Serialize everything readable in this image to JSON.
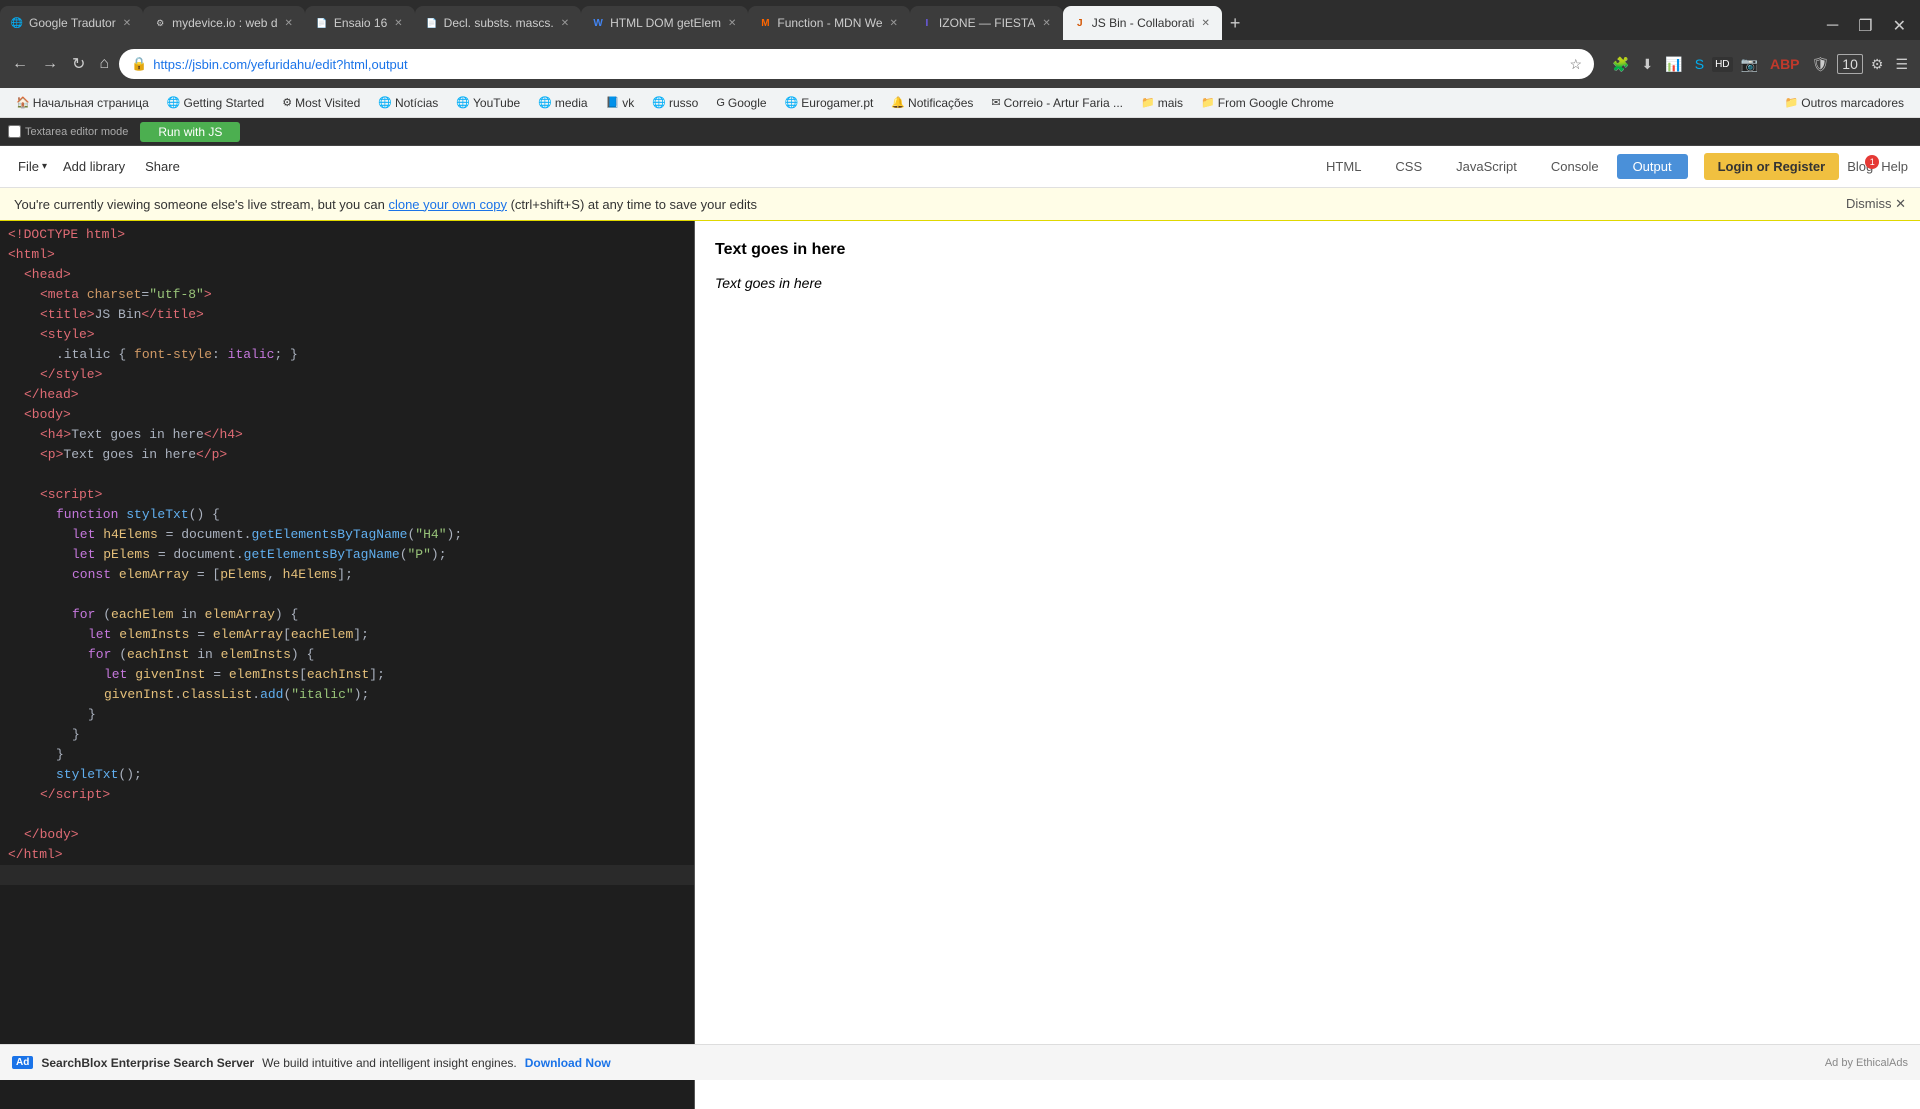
{
  "browser": {
    "tabs": [
      {
        "id": 1,
        "favicon": "🌐",
        "label": "Google Tradutor",
        "active": false,
        "closeable": true
      },
      {
        "id": 2,
        "favicon": "⚙️",
        "label": "mydevice.io : web d",
        "active": false,
        "closeable": true
      },
      {
        "id": 3,
        "favicon": "📄",
        "label": "Ensaio 16",
        "active": false,
        "closeable": true
      },
      {
        "id": 4,
        "favicon": "📄",
        "label": "Decl. substs. mascs.",
        "active": false,
        "closeable": true
      },
      {
        "id": 5,
        "favicon": "W",
        "label": "HTML DOM getElem",
        "active": false,
        "closeable": true
      },
      {
        "id": 6,
        "favicon": "M",
        "label": "Function - MDN We",
        "active": false,
        "closeable": true
      },
      {
        "id": 7,
        "favicon": "I",
        "label": "IZONE — FIESTA",
        "active": false,
        "closeable": true
      },
      {
        "id": 8,
        "favicon": "J",
        "label": "JS Bin - Collaborati",
        "active": true,
        "closeable": true
      }
    ],
    "url": "https://jsbin.com/yefuridahu/edit?html,output",
    "bookmarks": [
      {
        "icon": "🏠",
        "label": "Начальная страница"
      },
      {
        "icon": "🌐",
        "label": "Getting Started"
      },
      {
        "icon": "⚙️",
        "label": "Most Visited"
      },
      {
        "icon": "📰",
        "label": "Notícias"
      },
      {
        "icon": "▶️",
        "label": "YouTube"
      },
      {
        "icon": "🌐",
        "label": "media"
      },
      {
        "icon": "📘",
        "label": "vk"
      },
      {
        "icon": "🌐",
        "label": "russo"
      },
      {
        "icon": "G",
        "label": "Google"
      },
      {
        "icon": "🌐",
        "label": "Eurogamer.pt"
      },
      {
        "icon": "🔔",
        "label": "Notificações"
      },
      {
        "icon": "✉️",
        "label": "Correio - Artur Faria ..."
      },
      {
        "icon": "📁",
        "label": "mais"
      },
      {
        "icon": "📁",
        "label": "From Google Chrome"
      },
      {
        "icon": "📁",
        "label": "Outros marcadores"
      }
    ]
  },
  "jsbin": {
    "file_label": "File",
    "add_library_label": "Add library",
    "share_label": "Share",
    "panels": [
      {
        "id": "html",
        "label": "HTML",
        "active": false
      },
      {
        "id": "css",
        "label": "CSS",
        "active": false
      },
      {
        "id": "javascript",
        "label": "JavaScript",
        "active": false
      },
      {
        "id": "console",
        "label": "Console",
        "active": false
      },
      {
        "id": "output",
        "label": "Output",
        "active": true
      }
    ],
    "login_register_label": "Login or Register",
    "blog_label": "Blog",
    "blog_badge": "1",
    "help_label": "Help"
  },
  "notification": {
    "text_before": "You're currently viewing someone else's live stream, but you can ",
    "link_text": "clone your own copy",
    "text_after": " (ctrl+shift+S) at any time to save your edits",
    "dismiss_label": "Dismiss ✕"
  },
  "editor": {
    "textarea_mode_label": "Textarea editor mode",
    "run_label": "Run with JS"
  },
  "output": {
    "h4_text": "Text goes in here",
    "p_text": "Text goes in here"
  },
  "ad": {
    "icon": "Ad",
    "text": "SearchBlox Enterprise Search Server",
    "description": "We build intuitive and intelligent insight engines.",
    "link_text": "Download Now",
    "right_text": "Ad by EthicalAds"
  }
}
